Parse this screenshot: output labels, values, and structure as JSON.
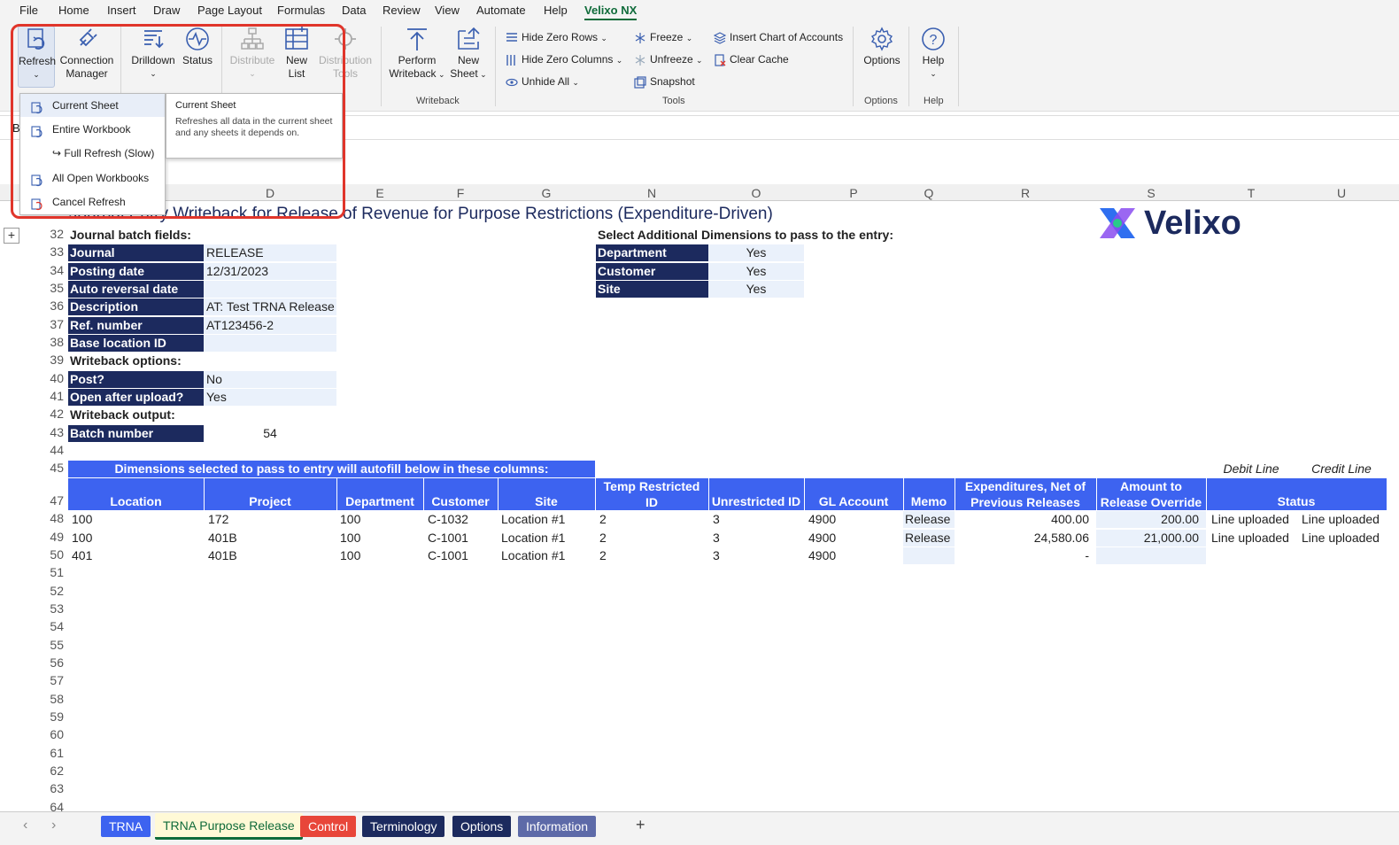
{
  "menubar": {
    "items": [
      "File",
      "Home",
      "Insert",
      "Draw",
      "Page Layout",
      "Formulas",
      "Data",
      "Review",
      "View",
      "Automate",
      "Help",
      "Velixo NX"
    ]
  },
  "ribbon": {
    "refresh": "Refresh",
    "connection_manager_1": "Connection",
    "connection_manager_2": "Manager",
    "drilldown": "Drilldown",
    "status": "Status",
    "distribute": "Distribute",
    "new_list_1": "New",
    "new_list_2": "List",
    "distribution_tools_1": "Distribution",
    "distribution_tools_2": "Tools",
    "perform_writeback_1": "Perform",
    "perform_writeback_2": "Writeback",
    "new_sheet_1": "New",
    "new_sheet_2": "Sheet",
    "writeback_group": "Writeback",
    "hide_zero_rows": "Hide Zero Rows",
    "hide_zero_columns": "Hide Zero Columns",
    "unhide_all": "Unhide All",
    "freeze": "Freeze",
    "unfreeze": "Unfreeze",
    "snapshot": "Snapshot",
    "insert_chart": "Insert Chart of Accounts",
    "clear_cache": "Clear Cache",
    "tools_group": "Tools",
    "options": "Options",
    "options_group": "Options",
    "help": "Help",
    "help_group": "Help"
  },
  "dropdown": {
    "items": [
      "Current Sheet",
      "Entire Workbook",
      "↪ Full Refresh (Slow)",
      "All Open Workbooks",
      "Cancel Refresh"
    ]
  },
  "tooltip": {
    "title": "Current Sheet",
    "body": "Refreshes all data in the current sheet and any sheets it depends on."
  },
  "formula_bar": {
    "namebox": "B"
  },
  "columns": [
    "D",
    "E",
    "F",
    "G",
    "N",
    "O",
    "P",
    "Q",
    "R",
    "S",
    "T",
    "U"
  ],
  "sheet": {
    "title": "Journal Entry Writeback for Release of Revenue for Purpose Restrictions (Expenditure-Driven)",
    "logo_text": "Velixo",
    "batch_fields_header": "Journal batch fields:",
    "fields": [
      {
        "label": "Journal",
        "value": "RELEASE"
      },
      {
        "label": "Posting date",
        "value": "12/31/2023"
      },
      {
        "label": "Auto reversal date",
        "value": ""
      },
      {
        "label": "Description",
        "value": "AT: Test TRNA Release"
      },
      {
        "label": "Ref. number",
        "value": "AT123456-2"
      },
      {
        "label": "Base location ID",
        "value": ""
      }
    ],
    "writeback_options_header": "Writeback options:",
    "options": [
      {
        "label": "Post?",
        "value": "No"
      },
      {
        "label": "Open after upload?",
        "value": "Yes"
      }
    ],
    "writeback_output_header": "Writeback output:",
    "batch_number_label": "Batch number",
    "batch_number_value": "54",
    "dims_header": "Select Additional Dimensions to pass to the entry:",
    "dims": [
      {
        "label": "Department",
        "value": "Yes"
      },
      {
        "label": "Customer",
        "value": "Yes"
      },
      {
        "label": "Site",
        "value": "Yes"
      }
    ],
    "autofill_banner": "Dimensions selected to pass to entry will autofill below in these columns:",
    "debit_line": "Debit Line",
    "credit_line": "Credit Line",
    "table_headers": [
      "Location",
      "Project",
      "Department",
      "Customer",
      "Site",
      "Temp Restricted ID",
      "Unrestricted ID",
      "GL Account",
      "Memo",
      "Expenditures, Net of Previous Releases",
      "Amount to Release Override",
      "Status"
    ],
    "temp_restricted_1": "Temp Restricted",
    "temp_restricted_2": "ID",
    "expenditures_1": "Expenditures, Net of",
    "expenditures_2": "Previous Releases",
    "amount_1": "Amount to",
    "amount_2": "Release Override",
    "rows": [
      {
        "location": "100",
        "project": "172",
        "department": "100",
        "customer": "C-1032",
        "site": "Location #1",
        "temp": "2",
        "unrestricted": "3",
        "gl": "4900",
        "memo": "Release",
        "expenditures": "400.00",
        "amount": "200.00",
        "debit": "Line uploaded",
        "credit": "Line uploaded"
      },
      {
        "location": "100",
        "project": "401B",
        "department": "100",
        "customer": "C-1001",
        "site": "Location #1",
        "temp": "2",
        "unrestricted": "3",
        "gl": "4900",
        "memo": "Release",
        "expenditures": "24,580.06",
        "amount": "21,000.00",
        "debit": "Line uploaded",
        "credit": "Line uploaded"
      },
      {
        "location": "401",
        "project": "401B",
        "department": "100",
        "customer": "C-1001",
        "site": "Location #1",
        "temp": "2",
        "unrestricted": "3",
        "gl": "4900",
        "memo": "",
        "expenditures": "-",
        "amount": "",
        "debit": "",
        "credit": ""
      }
    ]
  },
  "row_numbers": [
    "32",
    "33",
    "34",
    "35",
    "36",
    "37",
    "38",
    "39",
    "40",
    "41",
    "42",
    "43",
    "44",
    "45",
    "47",
    "48",
    "49",
    "50",
    "51",
    "52",
    "53",
    "54",
    "55",
    "56",
    "57",
    "58",
    "59",
    "60",
    "61",
    "62",
    "63",
    "64"
  ],
  "sheet_tabs": [
    {
      "label": "TRNA",
      "color": "#3d63f0"
    },
    {
      "label": "TRNA Purpose Release",
      "color": "#fff9d6"
    },
    {
      "label": "Control",
      "color": "#e8463a"
    },
    {
      "label": "Terminology",
      "color": "#1c2a5e"
    },
    {
      "label": "Options",
      "color": "#1c2a5e"
    },
    {
      "label": "Information",
      "color": "#5d6aa8"
    }
  ],
  "add_sheet": "+",
  "colors": {
    "accent": "#0f6b3a",
    "label_bg": "#1c2a5e",
    "header_bg": "#3d63f0",
    "highlight": "#e0352b"
  }
}
